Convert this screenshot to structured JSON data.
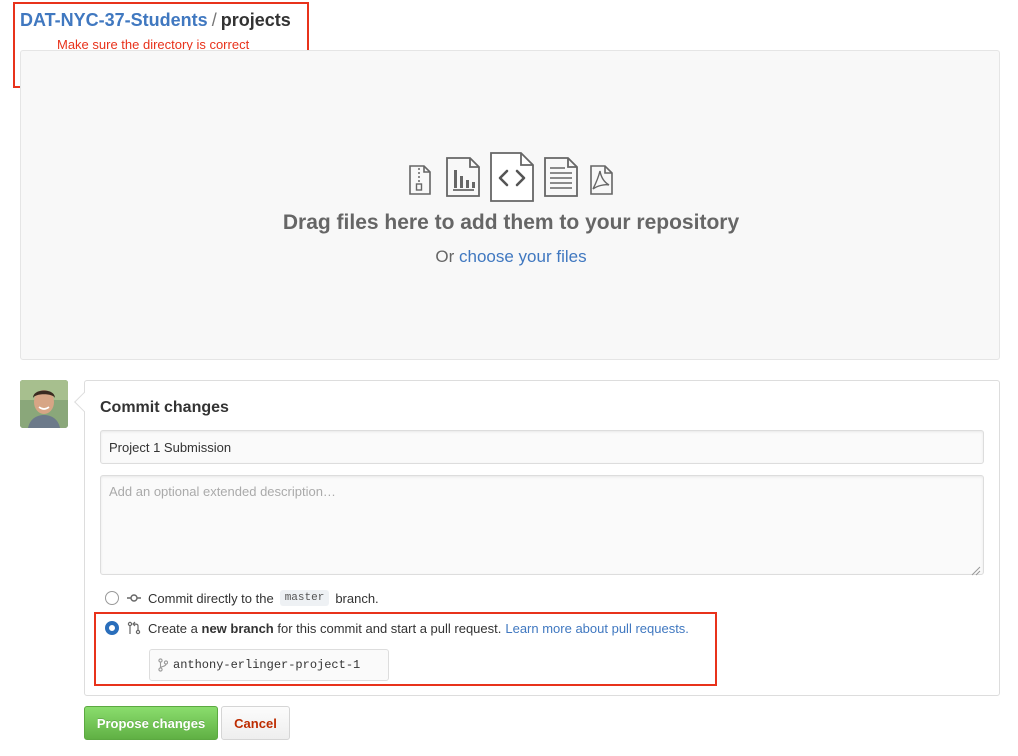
{
  "breadcrumb": {
    "owner": "DAT-NYC-37-Students",
    "separator": "/",
    "repo": "projects"
  },
  "annotation": {
    "note": "Make sure the directory is correct",
    "color": "#e8321b"
  },
  "dropzone": {
    "title": "Drag files here to add them to your repository",
    "subtitle_prefix": "Or",
    "choose_link": "choose your files",
    "icons": [
      "zip-file-icon",
      "chart-file-icon",
      "code-file-icon",
      "text-file-icon",
      "pdf-file-icon"
    ]
  },
  "commit": {
    "title": "Commit changes",
    "summary_value": "Project 1 Submission",
    "description_placeholder": "Add an optional extended description…",
    "options": {
      "direct": {
        "prefix": "Commit directly to the",
        "branch": "master",
        "suffix": "branch."
      },
      "new_branch": {
        "prefix": "Create a",
        "bold": "new branch",
        "suffix": "for this commit and start a pull request.",
        "link": "Learn more about pull requests.",
        "selected": true
      }
    },
    "branch_name": "anthony-erlinger-project-1"
  },
  "buttons": {
    "propose": "Propose changes",
    "cancel": "Cancel"
  },
  "colors": {
    "link": "#4078c0",
    "primary_green": "#6cc644",
    "cancel_red": "#bd2c00",
    "radio_selected": "#2a6ebb"
  }
}
